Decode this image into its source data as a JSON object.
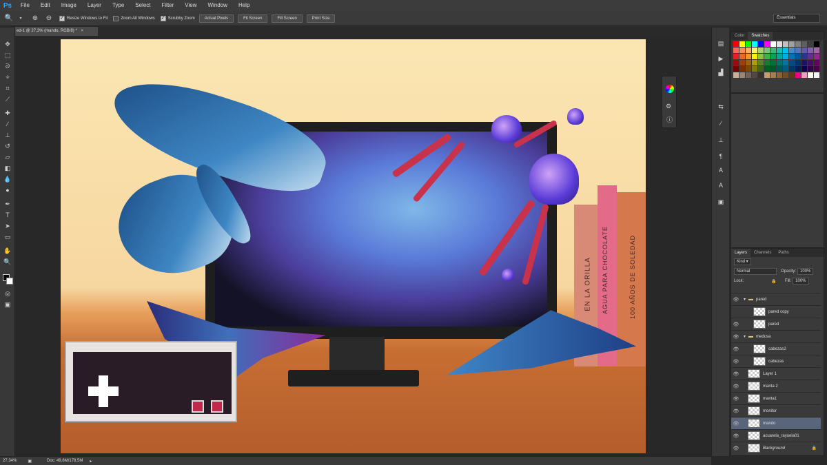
{
  "app": {
    "logo": "Ps"
  },
  "menu": [
    "File",
    "Edit",
    "Image",
    "Layer",
    "Type",
    "Select",
    "Filter",
    "View",
    "Window",
    "Help"
  ],
  "options": {
    "checks": [
      {
        "label": "Resize Windows to Fit",
        "checked": true
      },
      {
        "label": "Zoom All Windows",
        "checked": false
      },
      {
        "label": "Scrubby Zoom",
        "checked": true
      }
    ],
    "buttons": [
      "Actual Pixels",
      "Fit Screen",
      "Fill Screen",
      "Print Size"
    ],
    "workspace": "Essentials"
  },
  "document": {
    "tab_title": "ed-1 @ 27,3% (mando, RGB/8) *",
    "close": "×"
  },
  "status": {
    "zoom": "27,34%",
    "doc": "Doc: 49,8M/178,5M"
  },
  "artwork": {
    "book_titles": [
      "EN LA ORILLA",
      "AGUA PARA CHOCOLATE",
      "100 AÑOS DE SOLEDAD"
    ]
  },
  "color_panel": {
    "tabs": [
      "Color",
      "Swatches"
    ],
    "active": "Swatches"
  },
  "layers_panel": {
    "tabs": [
      "Layers",
      "Channels",
      "Paths"
    ],
    "kind": "Kind",
    "blend_mode": "Normal",
    "opacity_label": "Opacity:",
    "opacity_value": "100%",
    "lock_label": "Lock:",
    "fill_label": "Fill:",
    "fill_value": "100%",
    "layers": [
      {
        "name": "pared",
        "type": "group",
        "indent": 0,
        "visible": true,
        "selected": false
      },
      {
        "name": "pared copy",
        "type": "layer",
        "indent": 1,
        "visible": false,
        "selected": false
      },
      {
        "name": "pared",
        "type": "layer",
        "indent": 1,
        "visible": true,
        "selected": false
      },
      {
        "name": "medusa",
        "type": "group",
        "indent": 0,
        "visible": true,
        "selected": false
      },
      {
        "name": "cabezas2",
        "type": "layer",
        "indent": 1,
        "visible": true,
        "selected": false
      },
      {
        "name": "cabezas",
        "type": "layer",
        "indent": 1,
        "visible": true,
        "selected": false
      },
      {
        "name": "Layer 1",
        "type": "layer",
        "indent": 0,
        "visible": true,
        "selected": false
      },
      {
        "name": "manta 2",
        "type": "layer",
        "indent": 0,
        "visible": true,
        "selected": false
      },
      {
        "name": "manta1",
        "type": "layer",
        "indent": 0,
        "visible": true,
        "selected": false
      },
      {
        "name": "monitor",
        "type": "layer",
        "indent": 0,
        "visible": true,
        "selected": false
      },
      {
        "name": "mando",
        "type": "layer",
        "indent": 0,
        "visible": true,
        "selected": true
      },
      {
        "name": "acuarela_rayuela01",
        "type": "layer",
        "indent": 0,
        "visible": true,
        "selected": false
      },
      {
        "name": "Background",
        "type": "layer",
        "indent": 0,
        "visible": true,
        "selected": false
      }
    ]
  },
  "swatch_colors": [
    "#ff0000",
    "#ffff00",
    "#00ff00",
    "#00ffff",
    "#0000ff",
    "#ff00ff",
    "#ffffff",
    "#e0e0e0",
    "#c0c0c0",
    "#a0a0a0",
    "#808080",
    "#606060",
    "#404040",
    "#000000",
    "#f26c4f",
    "#f68e56",
    "#fbaf5d",
    "#fff568",
    "#acd372",
    "#7cc576",
    "#3bb878",
    "#1abbb4",
    "#00bff3",
    "#438ccb",
    "#5574b9",
    "#605ca8",
    "#855fa8",
    "#a763a8",
    "#ed1c24",
    "#f26522",
    "#f7941d",
    "#fff200",
    "#8dc63f",
    "#39b54a",
    "#00a651",
    "#00a99d",
    "#00aeef",
    "#0072bc",
    "#0054a6",
    "#2e3192",
    "#662d91",
    "#92278f",
    "#9e0b0f",
    "#a0410d",
    "#a36209",
    "#aba000",
    "#598527",
    "#197b30",
    "#007236",
    "#00746b",
    "#0076a3",
    "#004b80",
    "#003471",
    "#1b1464",
    "#440e62",
    "#630460",
    "#790000",
    "#7b2e00",
    "#7d4900",
    "#827b00",
    "#406618",
    "#005e20",
    "#005826",
    "#005952",
    "#005b7f",
    "#003663",
    "#002157",
    "#0d004c",
    "#32004b",
    "#4b0049",
    "#c7b299",
    "#998675",
    "#736357",
    "#534741",
    "#37302d",
    "#c69c6d",
    "#a67c52",
    "#8c6239",
    "#754c24",
    "#603913",
    "#ec008c",
    "#f49ac2",
    "#fff7e6",
    "#f2f2f2"
  ]
}
